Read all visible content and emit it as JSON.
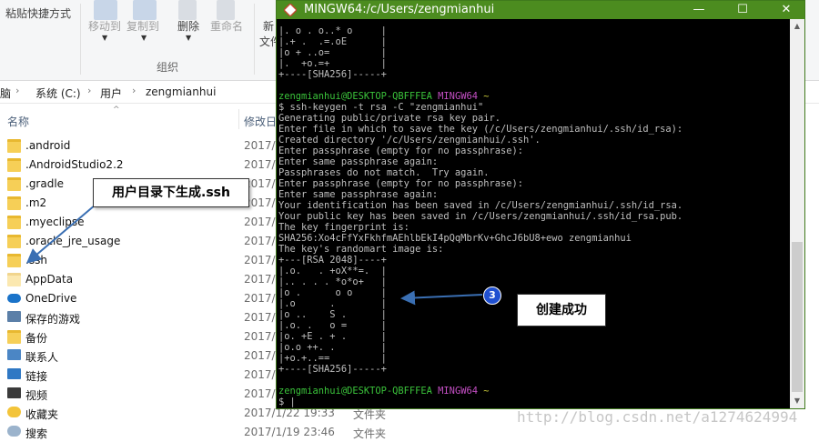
{
  "explorer": {
    "ribbon": {
      "paste_shortcut": "粘贴快捷方式",
      "move_to": "移动到",
      "copy_to": "复制到",
      "delete": "删除",
      "rename": "重命名",
      "new_folder_top": "新",
      "new_folder_bottom": "文件",
      "group_organize": "组织"
    },
    "breadcrumb": [
      "脑",
      "系统 (C:)",
      "用户",
      "zengmianhui"
    ],
    "columns": {
      "name": "名称",
      "modified": "修改日"
    },
    "rows": [
      {
        "name": ".android",
        "date": "2017/",
        "type": "",
        "icon": "folder"
      },
      {
        "name": ".AndroidStudio2.2",
        "date": "2017/",
        "type": "",
        "icon": "folder"
      },
      {
        "name": ".gradle",
        "date": "2017/",
        "type": "",
        "icon": "folder"
      },
      {
        "name": ".m2",
        "date": "2017/",
        "type": "",
        "icon": "folder"
      },
      {
        "name": ".myeclipse",
        "date": "2017/",
        "type": "",
        "icon": "folder"
      },
      {
        "name": ".oracle_jre_usage",
        "date": "2017/",
        "type": "",
        "icon": "folder"
      },
      {
        "name": ".ssh",
        "date": "2017/",
        "type": "",
        "icon": "folder"
      },
      {
        "name": "AppData",
        "date": "2017/",
        "type": "",
        "icon": "folder-faint"
      },
      {
        "name": "OneDrive",
        "date": "2017/",
        "type": "",
        "icon": "onedrive"
      },
      {
        "name": "保存的游戏",
        "date": "2017/",
        "type": "",
        "icon": "games"
      },
      {
        "name": "备份",
        "date": "2017/",
        "type": "",
        "icon": "folder"
      },
      {
        "name": "联系人",
        "date": "2017/",
        "type": "",
        "icon": "contacts"
      },
      {
        "name": "链接",
        "date": "2017/",
        "type": "",
        "icon": "links"
      },
      {
        "name": "视频",
        "date": "2017/",
        "type": "",
        "icon": "video"
      },
      {
        "name": "收藏夹",
        "date": "2017/1/22 19:33",
        "type": "文件夹",
        "icon": "favorites"
      },
      {
        "name": "搜索",
        "date": "2017/1/19 23:46",
        "type": "文件夹",
        "icon": "search"
      }
    ]
  },
  "terminal": {
    "title": "MINGW64:/c/Users/zengmianhui",
    "lines": [
      [
        {
          "t": "|. o . o..* o     |"
        }
      ],
      [
        {
          "t": "|.+ .  .=.oE      |"
        }
      ],
      [
        {
          "t": "|o + ..o=         |"
        }
      ],
      [
        {
          "t": "|.  +o.=+         |"
        }
      ],
      [
        {
          "t": "+----[SHA256]-----+"
        }
      ],
      [
        {
          "t": ""
        }
      ],
      [
        {
          "t": "zengmianhui@DESKTOP-QBFFFEA ",
          "c": "g"
        },
        {
          "t": "MINGW64 ",
          "c": "m"
        },
        {
          "t": "~",
          "c": "y"
        }
      ],
      [
        {
          "t": "$ ssh-keygen -t rsa -C \"zengmianhui\""
        }
      ],
      [
        {
          "t": "Generating public/private rsa key pair."
        }
      ],
      [
        {
          "t": "Enter file in which to save the key (/c/Users/zengmianhui/.ssh/id_rsa):"
        }
      ],
      [
        {
          "t": "Created directory '/c/Users/zengmianhui/.ssh'."
        }
      ],
      [
        {
          "t": "Enter passphrase (empty for no passphrase):"
        }
      ],
      [
        {
          "t": "Enter same passphrase again:"
        }
      ],
      [
        {
          "t": "Passphrases do not match.  Try again."
        }
      ],
      [
        {
          "t": "Enter passphrase (empty for no passphrase):"
        }
      ],
      [
        {
          "t": "Enter same passphrase again:"
        }
      ],
      [
        {
          "t": "Your identification has been saved in /c/Users/zengmianhui/.ssh/id_rsa."
        }
      ],
      [
        {
          "t": "Your public key has been saved in /c/Users/zengmianhui/.ssh/id_rsa.pub."
        }
      ],
      [
        {
          "t": "The key fingerprint is:"
        }
      ],
      [
        {
          "t": "SHA256:Xo4cFfYxFkhfmAEhlbEkI4pQqMbrKv+GhcJ6bU8+ewo zengmianhui"
        }
      ],
      [
        {
          "t": "The key's randomart image is:"
        }
      ],
      [
        {
          "t": "+---[RSA 2048]----+"
        }
      ],
      [
        {
          "t": "|.o.   . +oX**=.  |"
        }
      ],
      [
        {
          "t": "|.. . . . *o*o+   |"
        }
      ],
      [
        {
          "t": "|o .      o o     |"
        }
      ],
      [
        {
          "t": "|.o      .        |"
        }
      ],
      [
        {
          "t": "|o ..    S .      |"
        }
      ],
      [
        {
          "t": "|.o. .   o =      |"
        }
      ],
      [
        {
          "t": "|o. +E . + .      |"
        }
      ],
      [
        {
          "t": "|o.o ++. .        |"
        }
      ],
      [
        {
          "t": "|+o.+..==         |"
        }
      ],
      [
        {
          "t": "+----[SHA256]-----+"
        }
      ],
      [
        {
          "t": ""
        }
      ],
      [
        {
          "t": "zengmianhui@DESKTOP-QBFFFEA ",
          "c": "g"
        },
        {
          "t": "MINGW64 ",
          "c": "m"
        },
        {
          "t": "~",
          "c": "y"
        }
      ],
      [
        {
          "t": "$ |"
        }
      ]
    ]
  },
  "annotations": {
    "ssh_callout": "用户目录下生成.ssh",
    "success_callout": "创建成功",
    "step_badge": "3"
  },
  "watermark": "http://blog.csdn.net/a1274624994",
  "colors": {
    "terminal_title_bar": "#4c8c1f",
    "prompt_user": "#3bc43b",
    "prompt_mingw": "#c54fc5",
    "prompt_path": "#c8c83a",
    "arrow": "#3a6fb3",
    "badge": "#2050d0"
  }
}
